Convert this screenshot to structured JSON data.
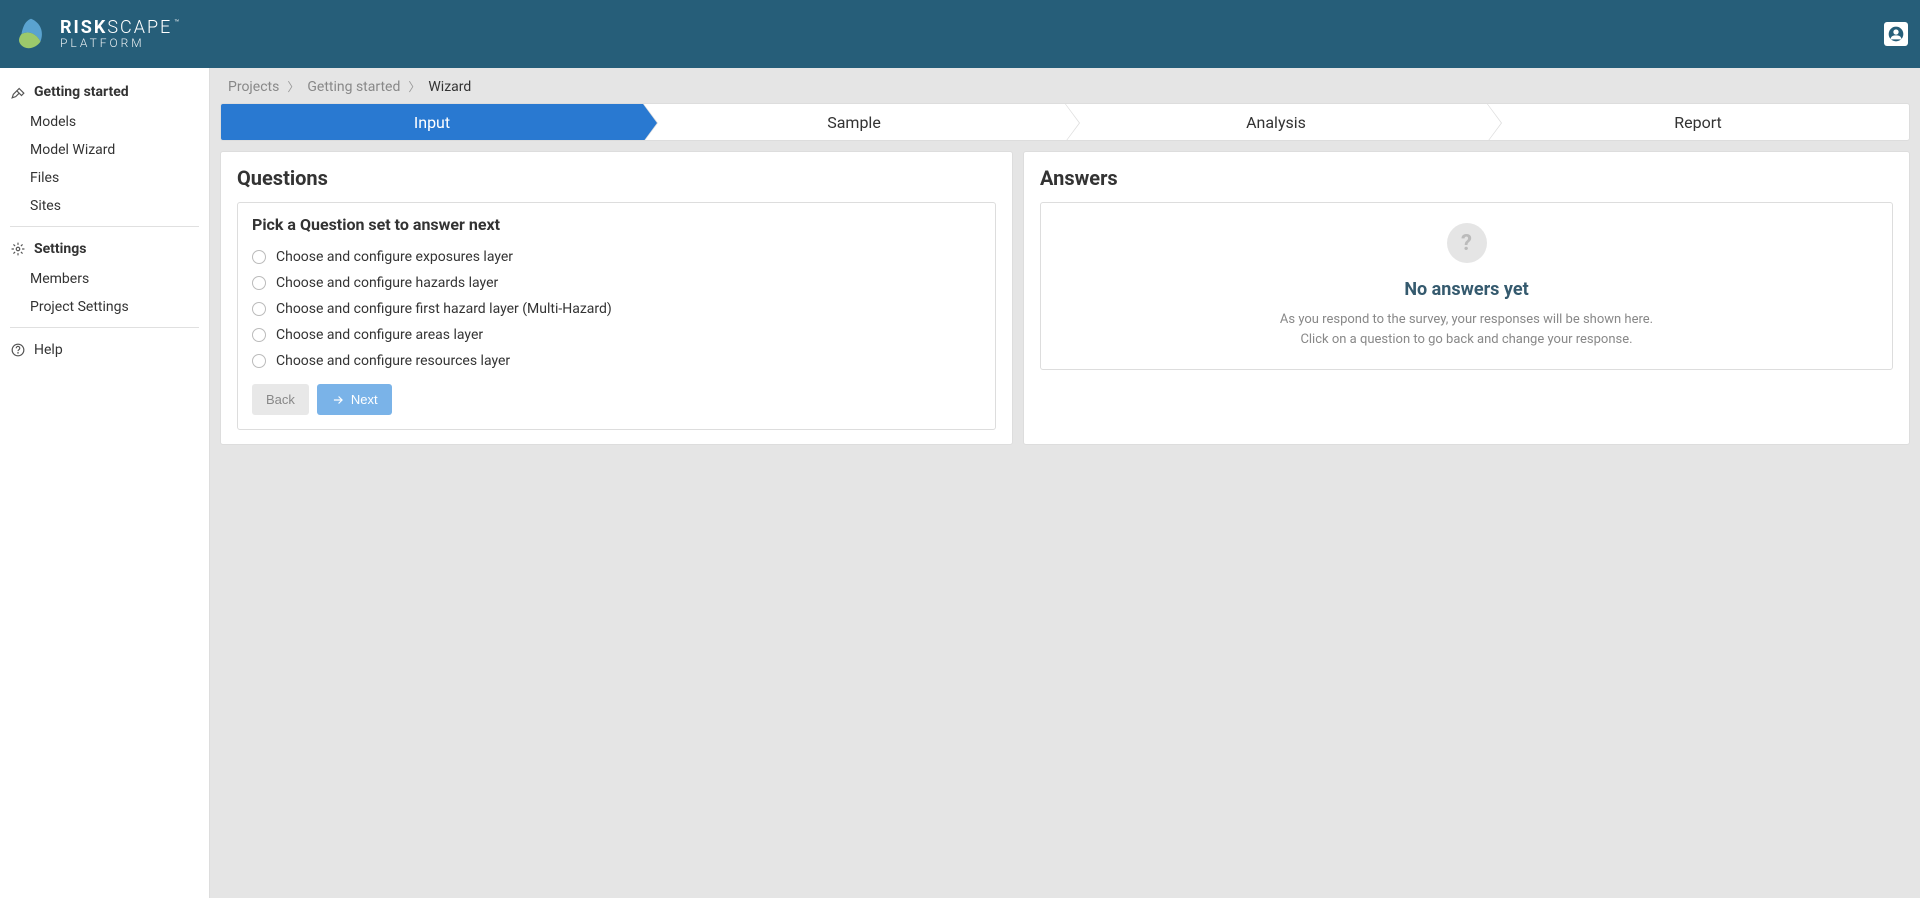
{
  "logo": {
    "line1_a": "RISK",
    "line1_b": "SCAPE",
    "line2": "PLATFORM",
    "tm": "™"
  },
  "sidebar": {
    "sections": [
      {
        "title": "Getting started",
        "icon": "wrench",
        "items": [
          "Models",
          "Model Wizard",
          "Files",
          "Sites"
        ]
      },
      {
        "title": "Settings",
        "icon": "gear",
        "items": [
          "Members",
          "Project Settings"
        ]
      }
    ],
    "help": "Help"
  },
  "breadcrumb": {
    "items": [
      "Projects",
      "Getting started"
    ],
    "current": "Wizard"
  },
  "steps": [
    "Input",
    "Sample",
    "Analysis",
    "Report"
  ],
  "active_step": 0,
  "questions": {
    "title": "Questions",
    "card_title": "Pick a Question set to answer next",
    "options": [
      "Choose and configure exposures layer",
      "Choose and configure hazards layer",
      "Choose and configure first hazard layer (Multi-Hazard)",
      "Choose and configure areas layer",
      "Choose and configure resources layer"
    ],
    "back": "Back",
    "next": "Next"
  },
  "answers": {
    "title": "Answers",
    "empty_title": "No answers yet",
    "empty_text": "As you respond to the survey, your responses will be shown here. Click on a question to go back and change your response."
  }
}
